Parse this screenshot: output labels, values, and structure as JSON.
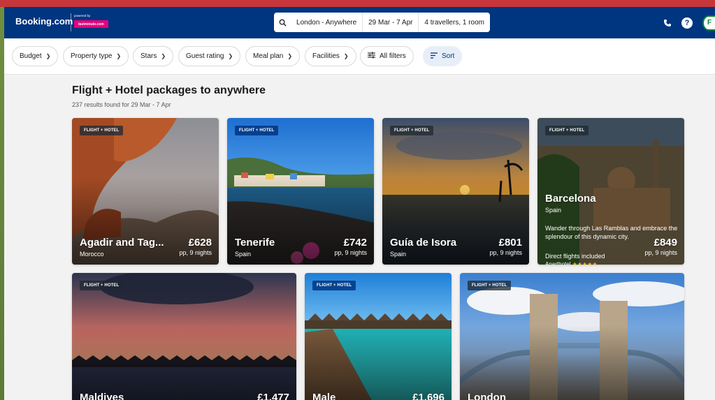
{
  "colors": {
    "brand_blue": "#003580",
    "accent_pink": "#e6007e",
    "star": "#febb02"
  },
  "header": {
    "brand": "Booking.com",
    "powered_by": "powered by",
    "partner": "lastminute.com",
    "search": {
      "destination": "London - Anywhere",
      "dates": "29 Mar - 7 Apr",
      "guests": "4 travellers, 1 room"
    },
    "icons": [
      "phone-icon",
      "help-icon",
      "avatar"
    ],
    "avatar_initial": "F"
  },
  "filters": [
    {
      "label": "Budget"
    },
    {
      "label": "Property type"
    },
    {
      "label": "Stars"
    },
    {
      "label": "Guest rating"
    },
    {
      "label": "Meal plan"
    },
    {
      "label": "Facilities"
    },
    {
      "label": "All filters"
    },
    {
      "label": "Sort"
    }
  ],
  "results": {
    "title": "Flight + Hotel packages to anywhere",
    "subtitle": "237 results found for 29 Mar - 7 Apr"
  },
  "cards": [
    {
      "badge": "FLIGHT + HOTEL",
      "name": "Agadir and Tag...",
      "country": "Morocco",
      "price": "£628",
      "pp": "pp, 9 nights"
    },
    {
      "badge": "FLIGHT + HOTEL",
      "name": "Tenerife",
      "country": "Spain",
      "price": "£742",
      "pp": "pp, 9 nights"
    },
    {
      "badge": "FLIGHT + HOTEL",
      "name": "Guía de Isora",
      "country": "Spain",
      "price": "£801",
      "pp": "pp, 9 nights"
    },
    {
      "badge": "FLIGHT + HOTEL",
      "name": "Barcelona",
      "country": "Spain",
      "description": "Wander through Las Ramblas and embrace the splendour of this dynamic city.",
      "price": "£849",
      "pp": "pp, 9 nights",
      "flights": "Direct flights included",
      "hotel_type": "Aparthotel",
      "stars": "★★★★★"
    },
    {
      "badge": "FLIGHT + HOTEL",
      "name": "Maldives",
      "price": "£1,477"
    },
    {
      "badge": "FLIGHT + HOTEL",
      "name": "Male",
      "price": "£1,696"
    },
    {
      "badge": "FLIGHT + HOTEL",
      "name": "London"
    }
  ]
}
